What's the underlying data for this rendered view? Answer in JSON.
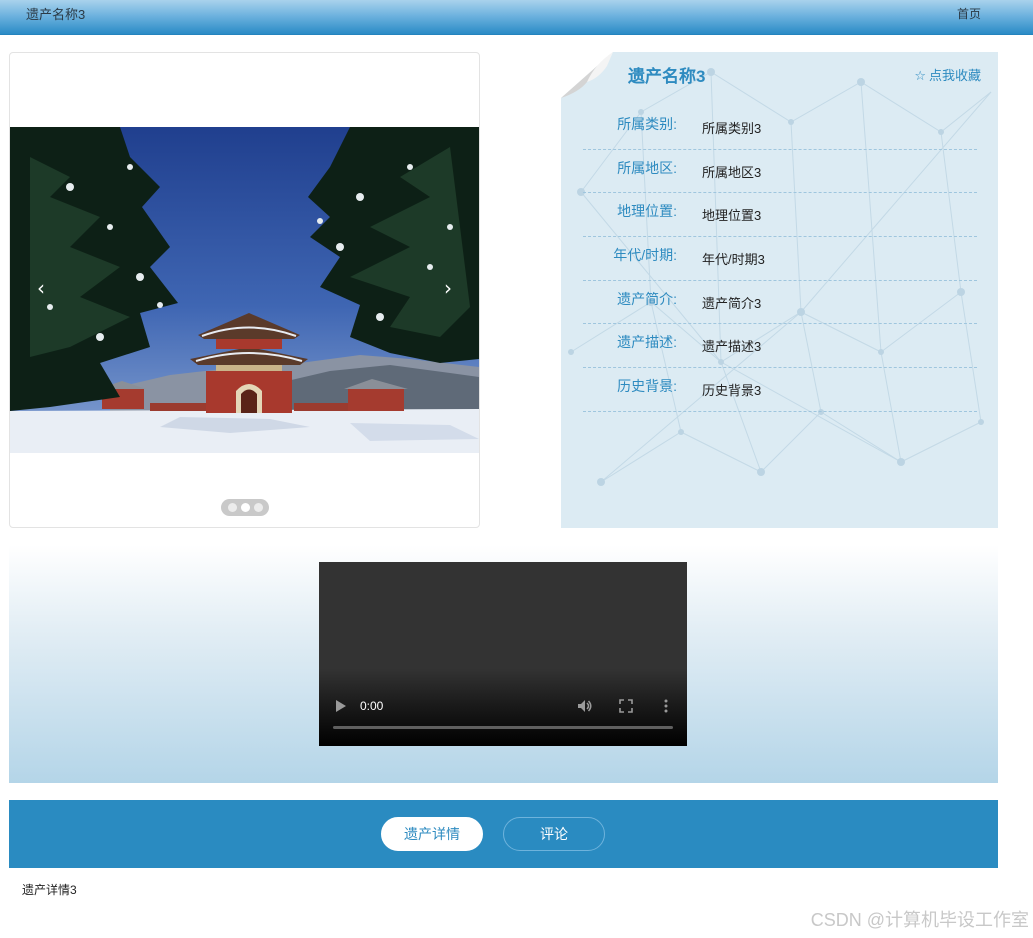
{
  "header": {
    "title": "遗产名称3",
    "home_link": "首页"
  },
  "carousel": {
    "slide_count": 3,
    "active_index": 1
  },
  "info": {
    "name": "遗产名称3",
    "favorite_label": "点我收藏",
    "fields": [
      {
        "label": "所属类别:",
        "value": "所属类别3"
      },
      {
        "label": "所属地区:",
        "value": "所属地区3"
      },
      {
        "label": "地理位置:",
        "value": "地理位置3"
      },
      {
        "label": "年代/时期:",
        "value": "年代/时期3"
      },
      {
        "label": "遗产简介:",
        "value": "遗产简介3"
      },
      {
        "label": "遗产描述:",
        "value": "遗产描述3"
      },
      {
        "label": "历史背景:",
        "value": "历史背景3"
      }
    ]
  },
  "video": {
    "time": "0:00"
  },
  "tabs": [
    {
      "label": "遗产详情",
      "active": true
    },
    {
      "label": "评论",
      "active": false
    }
  ],
  "detail_text": "遗产详情3",
  "watermark": "CSDN @计算机毕设工作室",
  "colors": {
    "accent": "#2e8bc0",
    "tabbar": "#2a8bc1",
    "panel": "#dcebf3"
  }
}
